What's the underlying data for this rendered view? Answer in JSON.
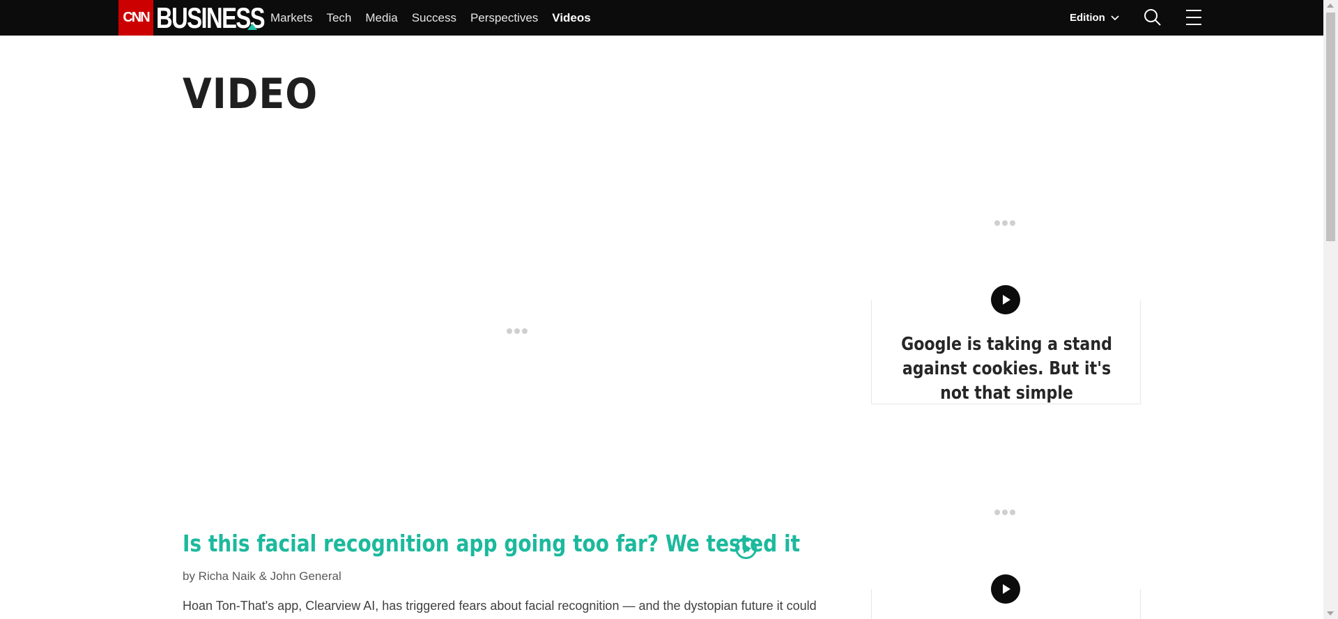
{
  "header": {
    "logo_cnn": "CNN",
    "logo_business": "BUSINESS",
    "nav": [
      "Markets",
      "Tech",
      "Media",
      "Success",
      "Perspectives",
      "Videos"
    ],
    "active_nav": "Videos",
    "edition_label": "Edition"
  },
  "page": {
    "title": "VIDEO"
  },
  "sidebar": {
    "cards": [
      {
        "title": "Google is taking a stand against cookies. But it's not that simple"
      },
      {
        "title": ""
      }
    ]
  },
  "main_story": {
    "title": "Is this facial recognition app going too far? We tested it",
    "byline": "by Richa Naik & John General",
    "summary": "Hoan Ton-That's app, Clearview AI, has triggered fears about facial recognition — and the dystopian future it could"
  },
  "colors": {
    "accent": "#1cb99d",
    "cnn_red": "#cc0000",
    "topbar": "#0c0c0c"
  },
  "icons": [
    "search-icon",
    "menu-icon",
    "chevron-down-icon",
    "play-icon"
  ]
}
